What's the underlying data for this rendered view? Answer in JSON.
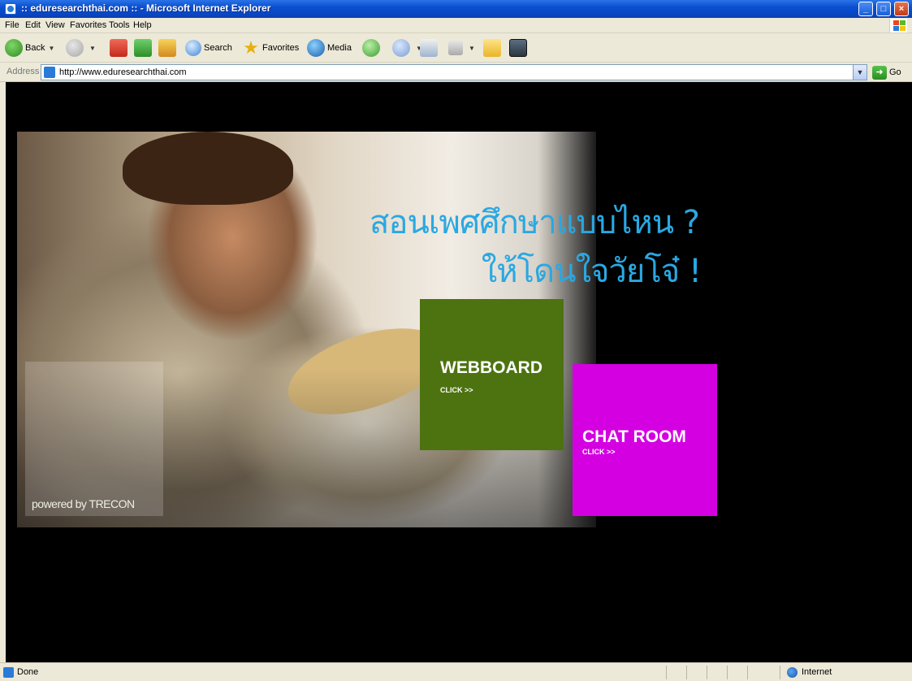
{
  "window": {
    "title": ":: eduresearchthai.com :: - Microsoft Internet Explorer",
    "minimize_icon": "minimize-icon",
    "maximize_icon": "maximize-icon",
    "close_icon": "close-icon"
  },
  "menu": {
    "items": [
      "File",
      "Edit",
      "View",
      "Favorites",
      "Tools",
      "Help"
    ]
  },
  "toolbar": {
    "back_label": "Back",
    "search_label": "Search",
    "favorites_label": "Favorites",
    "media_label": "Media"
  },
  "address": {
    "label": "Address",
    "url": "http://www.eduresearchthai.com",
    "go_label": "Go"
  },
  "page": {
    "headline_line1": "สอนเพศศึกษาแบบไหน ?",
    "headline_line2": "ให้โดนใจวัยโจ๋ !",
    "powered_by": "powered by TRECON",
    "webboard": {
      "title": "WEBBOARD",
      "click": "CLICK >>",
      "color": "#4d7311"
    },
    "chatroom": {
      "title": "CHAT ROOM",
      "click": "CLICK >>",
      "color": "#d400e2"
    },
    "headline_color": "#2aa8e2"
  },
  "status": {
    "text": "Done",
    "zone": "Internet"
  }
}
